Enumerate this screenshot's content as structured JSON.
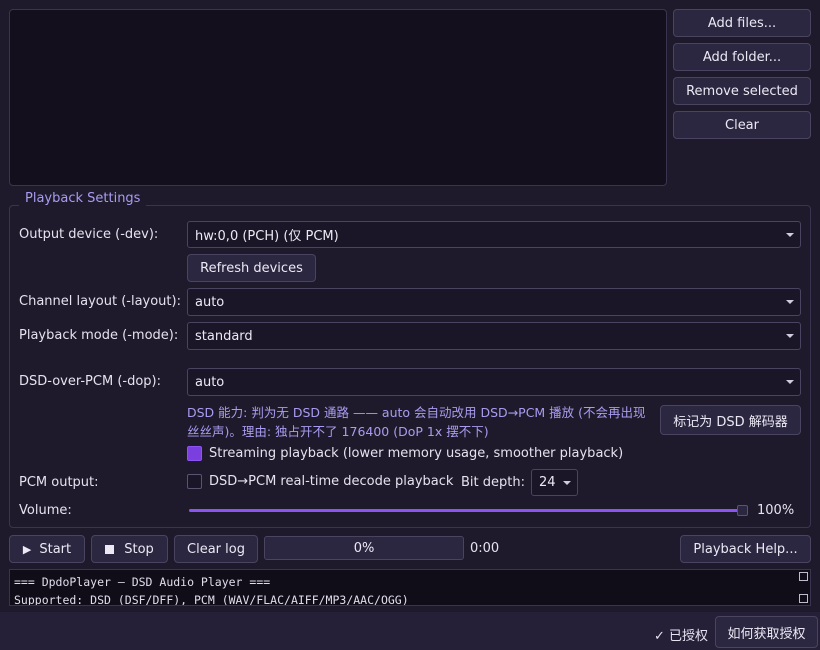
{
  "file_actions": {
    "add_files": "Add files...",
    "add_folder": "Add folder...",
    "remove_selected": "Remove selected",
    "clear": "Clear"
  },
  "settings": {
    "group_title": "Playback Settings",
    "output_device": {
      "label": "Output device (-dev):",
      "value": "hw:0,0 (PCH)  (仅 PCM)"
    },
    "refresh_devices": "Refresh devices",
    "channel_layout": {
      "label": "Channel layout (-layout):",
      "value": "auto"
    },
    "playback_mode": {
      "label": "Playback mode (-mode):",
      "value": "standard"
    },
    "dsd_over_pcm": {
      "label": "DSD-over-PCM (-dop):",
      "value": "auto"
    },
    "dsd_notice": "DSD 能力: 判为无 DSD 通路 —— auto 会自动改用 DSD→PCM 播放 (不会再出现丝丝声)。理由: 独占开不了 176400 (DoP 1x 摆不下)",
    "mark_dsd_decoder": "标记为 DSD 解码器",
    "streaming": {
      "label": "Streaming playback (lower memory usage, smoother playback)",
      "checked": true
    },
    "pcm_output_label": "PCM output:",
    "dsd_pcm_decode": {
      "label": "DSD→PCM real-time decode playback",
      "checked": false
    },
    "bit_depth": {
      "label": "Bit depth:",
      "value": "24"
    },
    "volume": {
      "label": "Volume:",
      "level_percent": 100,
      "display": "100%"
    }
  },
  "transport": {
    "start": "Start",
    "stop": "Stop",
    "clear_log": "Clear log",
    "progress_percent": 0,
    "progress_text": "0%",
    "time": "0:00",
    "playback_help": "Playback Help..."
  },
  "log": {
    "lines": [
      "=== DpdoPlayer — DSD Audio Player ===",
      "Supported: DSD (DSF/DFF), PCM (WAV/FLAC/AIFF/MP3/AAC/OGG)"
    ]
  },
  "footer": {
    "licensed": "✓ 已授权",
    "get_license": "如何获取授权"
  },
  "colors": {
    "accent": "#7b3fe0",
    "notice_text": "#a99cf0",
    "background": "#1e1a2b"
  }
}
